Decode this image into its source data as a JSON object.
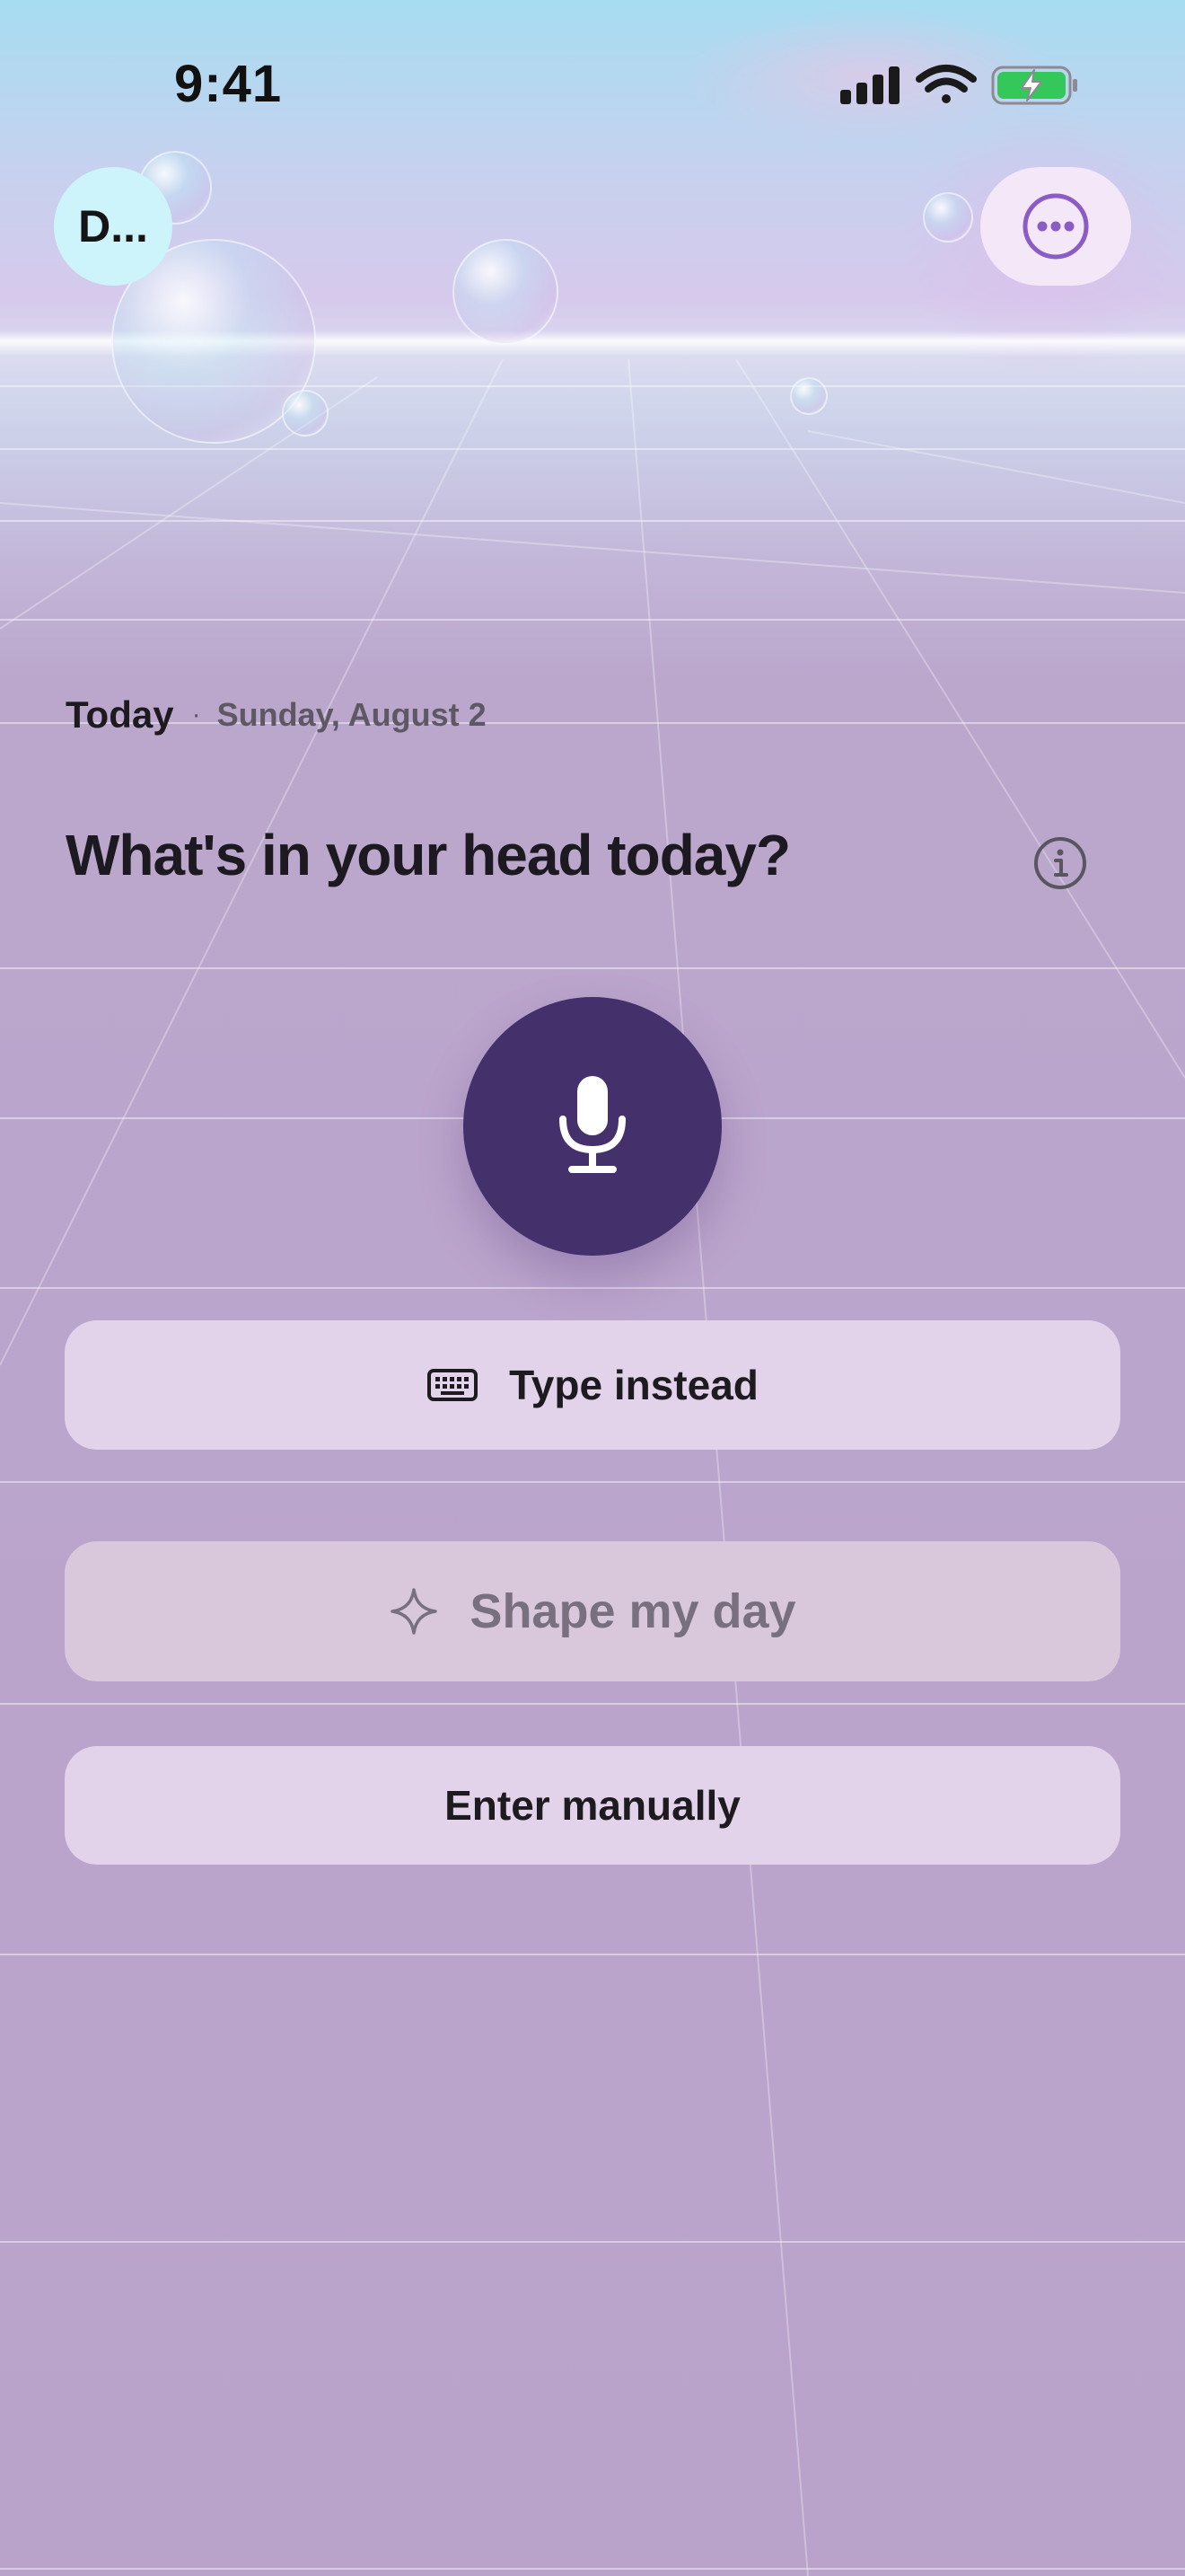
{
  "status_bar": {
    "time": "9:41",
    "icons": [
      "cellular-signal-icon",
      "wifi-icon",
      "battery-charging-icon"
    ]
  },
  "header": {
    "avatar_label": "D...",
    "more_icon": "ellipsis-circle-icon"
  },
  "date": {
    "today_label": "Today",
    "separator": "·",
    "full_date": "Sunday, August 2"
  },
  "prompt": {
    "headline": "What's in your head today?",
    "info_icon": "info-icon"
  },
  "actions": {
    "mic_icon": "microphone-icon",
    "type_instead_label": "Type instead",
    "type_instead_icon": "keyboard-icon",
    "shape_day_label": "Shape my day",
    "shape_day_icon": "sparkle-icon",
    "enter_manually_label": "Enter manually"
  },
  "colors": {
    "accent_dark": "#44306a",
    "accent_purple": "#8a5cc4",
    "background": "#b9a3cb",
    "pill": "#e2d3ea",
    "battery_green": "#34c759"
  }
}
